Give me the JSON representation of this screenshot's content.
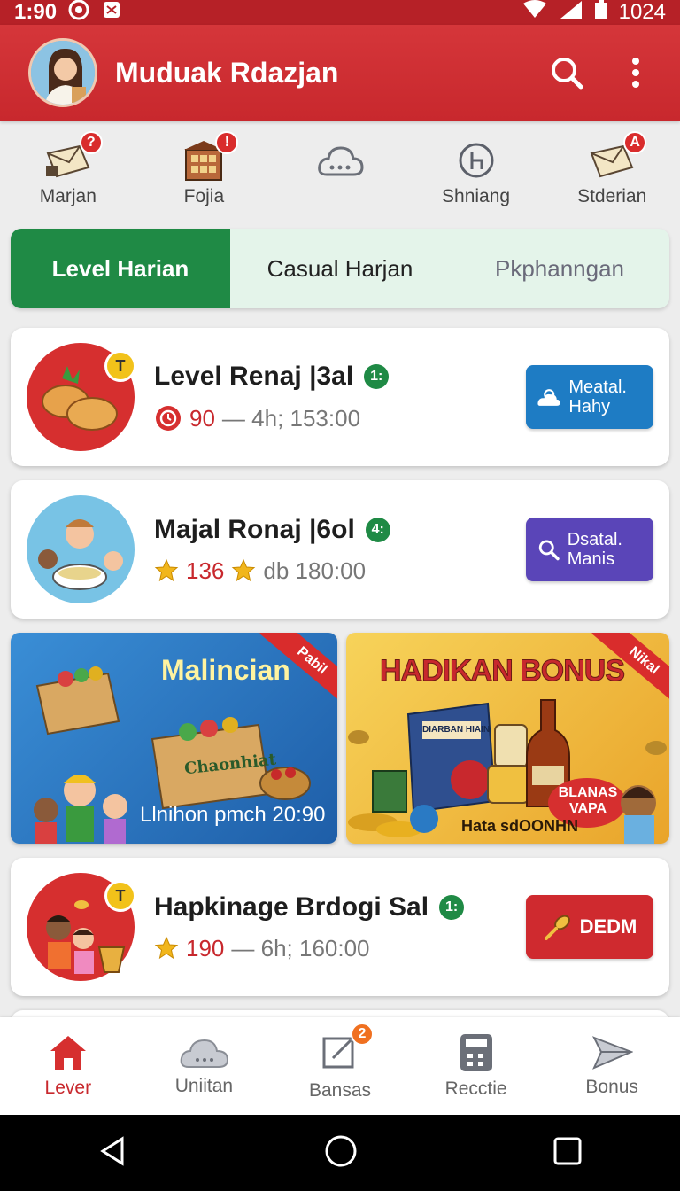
{
  "status_bar": {
    "time": "1:90",
    "battery": "1024"
  },
  "app_bar": {
    "title": "Muduak Rdazjan"
  },
  "quick_nav": [
    {
      "label": "Marjan",
      "badge": "?"
    },
    {
      "label": "Fojia",
      "badge": "!"
    },
    {
      "label": "",
      "badge": ""
    },
    {
      "label": "Shniang",
      "badge": ""
    },
    {
      "label": "Stderian",
      "badge": "A"
    }
  ],
  "tabs": [
    "Level Harian",
    "Casual Harjan",
    "Pkphanngan"
  ],
  "cards": [
    {
      "title": "Level Renaj |3al",
      "level": "1:",
      "coin_badge": "T",
      "meta_num": "90",
      "meta_text": "— 4h; 153:00",
      "button": "Meatal. Hahy",
      "button_color": "#1e7cc4"
    },
    {
      "title": "Majal Ronaj |6ol",
      "level": "4:",
      "coin_badge": "",
      "meta_num": "136",
      "meta_text": "db  180:00",
      "button": "Dsatal. Manis",
      "button_color": "#5a45b8"
    },
    {
      "title": "Hapkinage Brdogi Sal",
      "level": "1:",
      "coin_badge": "T",
      "meta_num": "190",
      "meta_text": "— 6h; 160:00",
      "button": "DEDM",
      "button_color": "#cf2a2f"
    }
  ],
  "banners": [
    {
      "title": "Malincian",
      "box_text": "Chaonhiat",
      "caption": "Llnihon pmch 20:90",
      "ribbon": "Pabil"
    },
    {
      "title": "HADIKAN BONUS",
      "box_text": "DIARBAN HIAIN",
      "caption": "Hata sdOONHN",
      "bubble": "BLANAS VAPA",
      "ribbon": "Nikal"
    }
  ],
  "bottom_nav": [
    {
      "label": "Lever",
      "badge": ""
    },
    {
      "label": "Uniitan",
      "badge": ""
    },
    {
      "label": "Bansas",
      "badge": "2"
    },
    {
      "label": "Recctie",
      "badge": ""
    },
    {
      "label": "Bonus",
      "badge": ""
    }
  ],
  "colors": {
    "primary_red": "#c8282d",
    "active_green": "#1f8a45"
  }
}
